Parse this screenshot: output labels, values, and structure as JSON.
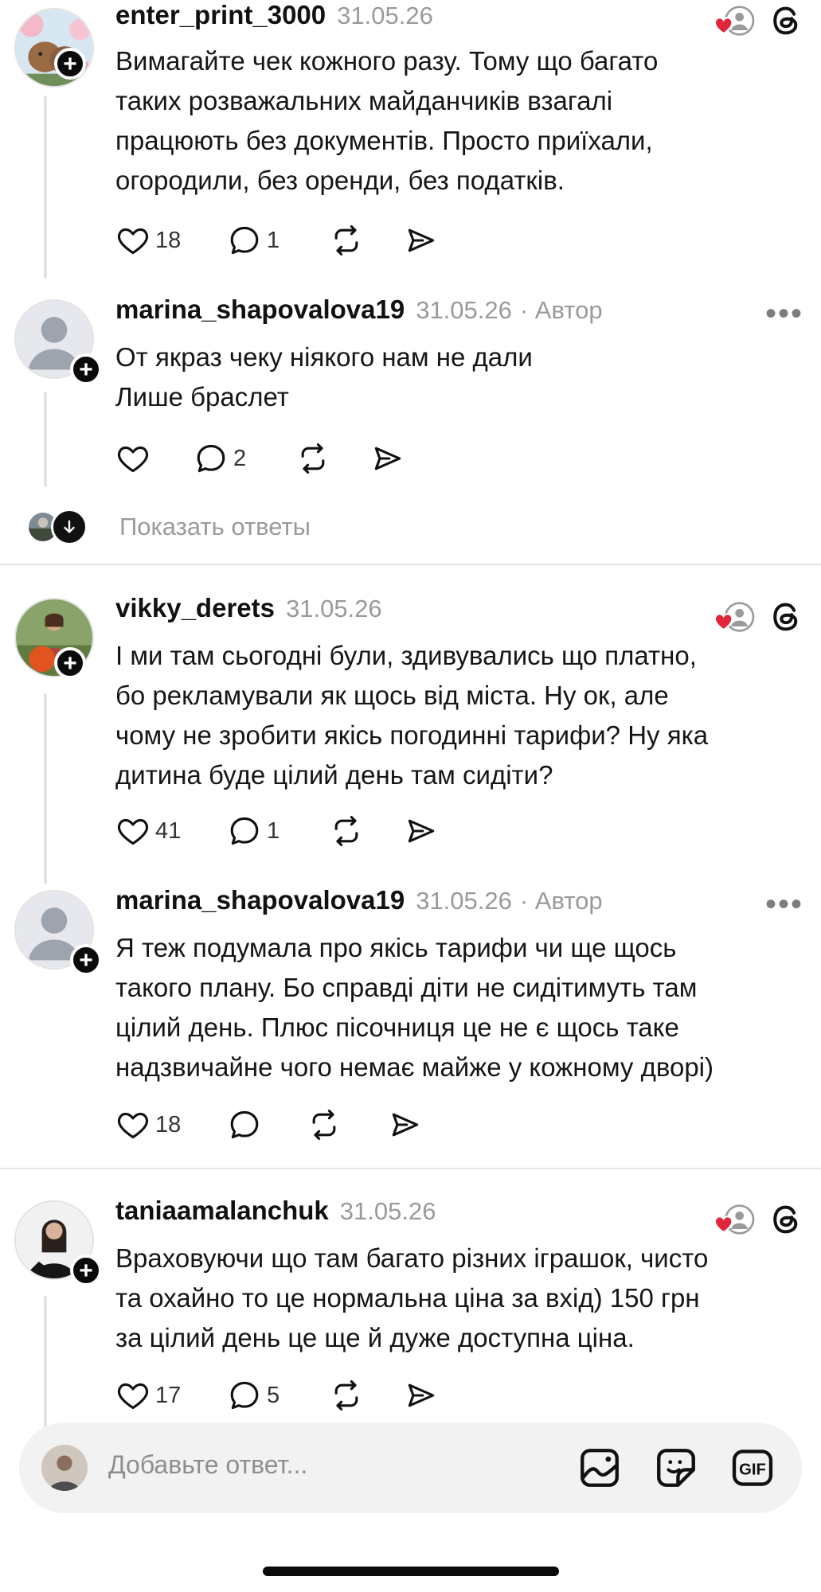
{
  "posts": [
    {
      "username": "enter_print_3000",
      "date": "31.05.26",
      "author_badge": "",
      "text": "Вимагайте чек кожного разу. Тому що багато\nтаких розважальних майданчиків взагалі\nпрацюють без документів. Просто приїхали,\nогородили, без оренди, без податків.",
      "likes": "18",
      "replies": "1"
    },
    {
      "username": "marina_shapovalova19",
      "date": "31.05.26",
      "author_badge": "· Автор",
      "text": "От якраз чеку ніякого нам не дали\nЛише браслет",
      "likes": "",
      "replies": "2"
    },
    {
      "username": "vikky_derets",
      "date": "31.05.26",
      "author_badge": "",
      "text": "І ми там сьогодні були, здивувались що платно,\nбо рекламували як щось від міста. Ну ок, але\nчому не зробити якісь погодинні тарифи? Ну яка\nдитина буде цілий день там сидіти?",
      "likes": "41",
      "replies": "1"
    },
    {
      "username": "marina_shapovalova19",
      "date": "31.05.26",
      "author_badge": "· Автор",
      "text": "Я теж подумала про якісь тарифи чи ще щось\nтакого плану. Бо справді діти не сидітимуть там\nцілий день. Плюс пісочниця це не є щось таке\nнадзвичайне чого немає майже у кожному дворі)",
      "likes": "18",
      "replies": ""
    },
    {
      "username": "taniaamalanchuk",
      "date": "31.05.26",
      "author_badge": "",
      "text": "Враховуючи що там багато різних іграшок, чисто\nта охайно то це нормальна ціна за вхід) 150 грн\nза цілий день це ще й дуже доступна  ціна.",
      "likes": "17",
      "replies": "5"
    }
  ],
  "show_replies_label": "Показать ответы",
  "composer": {
    "placeholder": "Добавьте ответ...",
    "icons": [
      "image-icon",
      "sticker-icon",
      "gif-icon"
    ]
  },
  "icons": {
    "like": "heart-outline-icon",
    "reply": "speech-bubble-icon",
    "repost": "repost-icon",
    "share": "send-icon",
    "liked_by_author": "heart-with-avatar-icon",
    "threads": "threads-logo-icon",
    "more": "more-dots-icon"
  },
  "colors": {
    "accent_heart": "#e0263b",
    "muted_text": "#9a9a9a",
    "divider": "#e6e6e6"
  }
}
